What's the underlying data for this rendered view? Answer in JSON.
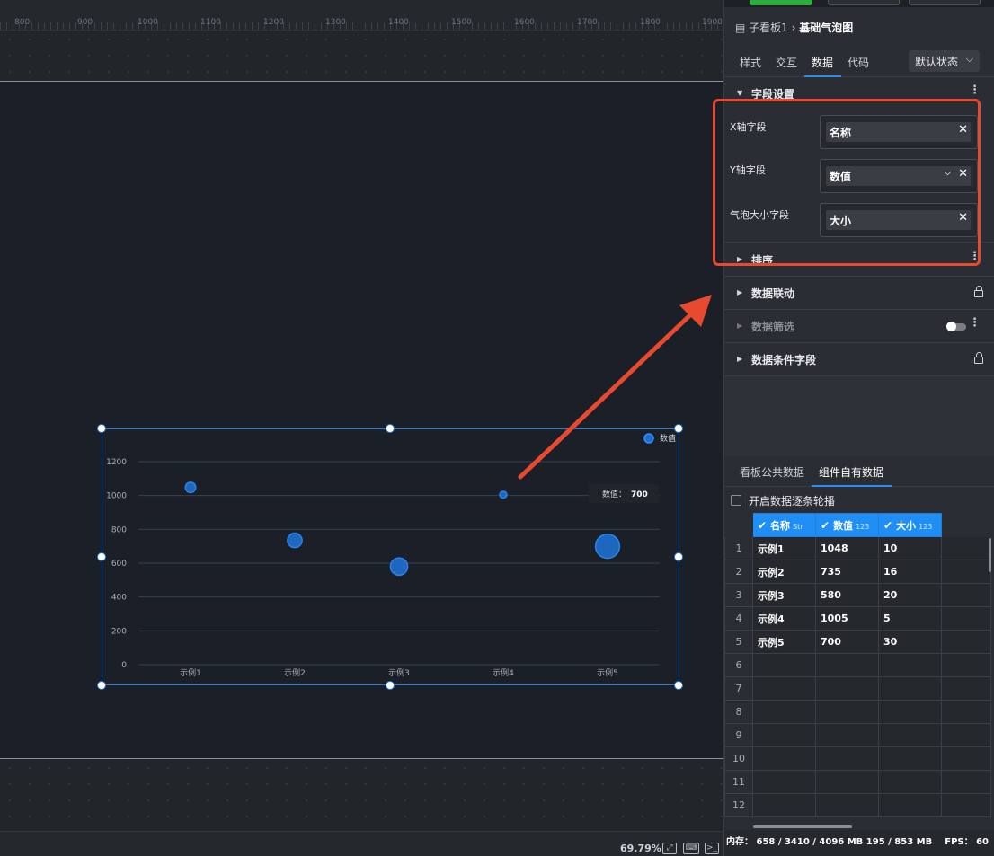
{
  "ruler": {
    "ticks": [
      "800",
      "900",
      "1000",
      "1100",
      "1200",
      "1300",
      "1400",
      "1500",
      "1600",
      "1700",
      "1800",
      "1900"
    ]
  },
  "chart_data": {
    "type": "scatter",
    "categories": [
      "示例1",
      "示例2",
      "示例3",
      "示例4",
      "示例5"
    ],
    "values": [
      1048,
      735,
      580,
      1005,
      700
    ],
    "sizes": [
      10,
      16,
      20,
      5,
      30
    ],
    "ylim": [
      0,
      1200
    ],
    "yticks": [
      "0",
      "200",
      "400",
      "600",
      "800",
      "1000",
      "1200"
    ],
    "legend": "数值",
    "tooltip": {
      "label": "数值：",
      "value": "700"
    },
    "colors": {
      "bubble": "#1e6fd0",
      "bubble_stroke": "#2f8cff",
      "grid": "#394150"
    }
  },
  "status": {
    "zoom": "69.79%"
  },
  "panel": {
    "breadcrumb": {
      "parent": "子看板1",
      "sep": "›",
      "current": "基础气泡图"
    },
    "tabs": [
      "样式",
      "交互",
      "数据",
      "代码"
    ],
    "state_select": "默认状态",
    "sections": {
      "fields": "字段设置",
      "sort": "排序",
      "linkage": "数据联动",
      "filter": "数据筛选",
      "condition": "数据条件字段"
    },
    "fields": [
      {
        "label": "X轴字段",
        "value": "名称",
        "has_dropdown": false
      },
      {
        "label": "Y轴字段",
        "value": "数值",
        "has_dropdown": true
      },
      {
        "label": "气泡大小字段",
        "value": "大小",
        "has_dropdown": false
      }
    ],
    "data_tabs": [
      "看板公共数据",
      "组件自有数据"
    ],
    "carousel_label": "开启数据逐条轮播",
    "table": {
      "headers": [
        {
          "name": "名称",
          "type": "Str"
        },
        {
          "name": "数值",
          "type": "123"
        },
        {
          "name": "大小",
          "type": "123"
        }
      ],
      "rows": [
        [
          "1",
          "示例1",
          "1048",
          "10"
        ],
        [
          "2",
          "示例2",
          "735",
          "16"
        ],
        [
          "3",
          "示例3",
          "580",
          "20"
        ],
        [
          "4",
          "示例4",
          "1005",
          "5"
        ],
        [
          "5",
          "示例5",
          "700",
          "30"
        ],
        [
          "6",
          "",
          "",
          ""
        ],
        [
          "7",
          "",
          "",
          ""
        ],
        [
          "8",
          "",
          "",
          ""
        ],
        [
          "9",
          "",
          "",
          ""
        ],
        [
          "10",
          "",
          "",
          ""
        ],
        [
          "11",
          "",
          "",
          ""
        ],
        [
          "12",
          "",
          "",
          ""
        ]
      ]
    },
    "memory": "内存：  658 / 3410 / 4096 MB  195 / 853 MB",
    "fps": "FPS：  60"
  }
}
